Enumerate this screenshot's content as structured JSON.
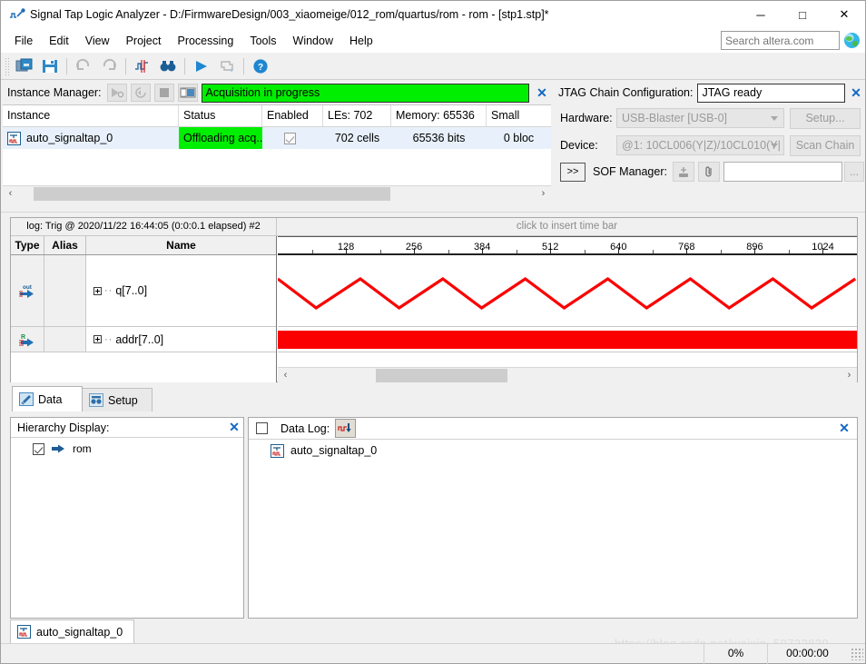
{
  "window": {
    "title": "Signal Tap Logic Analyzer - D:/FirmwareDesign/003_xiaomeige/012_rom/quartus/rom - rom - [stp1.stp]*",
    "icon": "signaltap-icon",
    "minimize": "─",
    "maximize": "□",
    "close": "✕"
  },
  "menu": {
    "items": [
      {
        "label": "File"
      },
      {
        "label": "Edit"
      },
      {
        "label": "View"
      },
      {
        "label": "Project"
      },
      {
        "label": "Processing"
      },
      {
        "label": "Tools"
      },
      {
        "label": "Window"
      },
      {
        "label": "Help"
      }
    ]
  },
  "search": {
    "placeholder": "Search altera.com",
    "value": ""
  },
  "toolbar": {
    "buttons": [
      {
        "name": "open-project-icon"
      },
      {
        "name": "save-icon"
      },
      {
        "name": "undo-icon"
      },
      {
        "name": "redo-icon"
      },
      {
        "name": "signaltap-settings-icon"
      },
      {
        "name": "find-icon"
      },
      {
        "name": "run-analysis-icon"
      },
      {
        "name": "stop-analysis-icon"
      },
      {
        "name": "help-icon"
      }
    ]
  },
  "instance_manager": {
    "label": "Instance Manager:",
    "status_banner": "Acquisition in progress",
    "close": "✕",
    "tool_buttons": [
      {
        "name": "run-analysis-button"
      },
      {
        "name": "rerun-analysis-button"
      },
      {
        "name": "stop-analysis-button"
      },
      {
        "name": "read-data-button"
      }
    ],
    "columns": [
      {
        "label": "Instance",
        "width": 194
      },
      {
        "label": "Status",
        "width": 92
      },
      {
        "label": "Enabled",
        "width": 67
      },
      {
        "label": "LEs: 702",
        "width": 75
      },
      {
        "label": "Memory: 65536",
        "width": 105
      },
      {
        "label": "Small",
        "width": 71
      }
    ],
    "rows": [
      {
        "instance": "auto_signaltap_0",
        "status": "Offloading acq...",
        "enabled": true,
        "les": "702 cells",
        "memory": "65536 bits",
        "small": "0 bloc"
      }
    ],
    "scrollbar": {
      "left_arrow": "‹",
      "right_arrow": "›",
      "thumb_start_pct": 3,
      "thumb_width_pct": 69
    }
  },
  "jtag": {
    "title": "JTAG Chain Configuration:",
    "status": "JTAG ready",
    "close": "✕",
    "hardware_label": "Hardware:",
    "hardware_value": "USB-Blaster [USB-0]",
    "setup_button": "Setup...",
    "device_label": "Device:",
    "device_value": "@1: 10CL006(Y|Z)/10CL010(Y|",
    "scan_chain_button": "Scan Chain",
    "expand_button": ">>",
    "sof_label": "SOF Manager:",
    "sof_value": "",
    "sof_dots_button": "..."
  },
  "waveform": {
    "log_title": "log: Trig @ 2020/11/22 16:44:05 (0:0:0.1 elapsed) #2",
    "time_bar_hint": "click to insert time bar",
    "columns": {
      "type": "Type",
      "alias": "Alias",
      "name": "Name"
    },
    "signals": [
      {
        "type_icon": "output-signal-icon",
        "alias": "",
        "name": "q[7..0]",
        "expander": "+"
      },
      {
        "type_icon": "registered-signal-icon",
        "alias": "",
        "name": "addr[7..0]",
        "expander": "+"
      }
    ],
    "scrollbar": {
      "left_arrow": "‹",
      "right_arrow": "›",
      "thumb_start_pct": 15,
      "thumb_width_pct": 24
    }
  },
  "chart_data": {
    "type": "line",
    "title": "log: Trig @ 2020/11/22 16:44:05 (0:0:0.1 elapsed) #2",
    "xlabel": "",
    "ylabel": "",
    "grid": false,
    "legend": "none",
    "xlim": [
      0,
      1088
    ],
    "tick_labels": [
      "128",
      "256",
      "384",
      "512",
      "640",
      "768",
      "896",
      "1024"
    ],
    "tick_values": [
      128,
      256,
      384,
      512,
      640,
      768,
      896,
      1024
    ],
    "series": [
      {
        "name": "q[7..0]",
        "color": "#fa0000",
        "waveform": "triangle",
        "description": "red triangular (up-down ramp) bus value envelope",
        "x": [
          0,
          72,
          155,
          228,
          310,
          383,
          465,
          538,
          620,
          693,
          775,
          848,
          930,
          1003,
          1085
        ],
        "y": [
          255,
          0,
          255,
          0,
          255,
          0,
          255,
          0,
          255,
          0,
          255,
          0,
          255,
          0,
          255
        ]
      },
      {
        "name": "addr[7..0]",
        "color": "#fa0000",
        "waveform": "bus-solid",
        "description": "solid red bus band (transitions too dense to resolve)",
        "x": [
          0,
          1085
        ],
        "y": [
          1,
          1
        ]
      }
    ]
  },
  "tabs": [
    {
      "label": "Data",
      "icon": "data-tab-icon",
      "active": true
    },
    {
      "label": "Setup",
      "icon": "setup-tab-icon",
      "active": false
    }
  ],
  "hierarchy": {
    "title": "Hierarchy Display:",
    "close": "✕",
    "items": [
      {
        "label": "rom",
        "checked": true,
        "icon": "node-icon"
      }
    ]
  },
  "data_log": {
    "title": "Data Log:",
    "checked": false,
    "close": "✕",
    "toolbutton": "save-data-icon",
    "items": [
      {
        "label": "auto_signaltap_0",
        "icon": "signaltap-instance-icon"
      }
    ]
  },
  "bottom_tab": {
    "label": "auto_signaltap_0",
    "icon": "signaltap-instance-icon"
  },
  "statusbar": {
    "progress": "0%",
    "elapsed": "00:00:00"
  },
  "watermark": "https://blog.csdn.net/weixin_50722839",
  "colors": {
    "accent_green": "#00ee00",
    "waveform_red": "#fa0000",
    "selection_blue": "#e8f1fb",
    "link_blue": "#1168c4"
  }
}
